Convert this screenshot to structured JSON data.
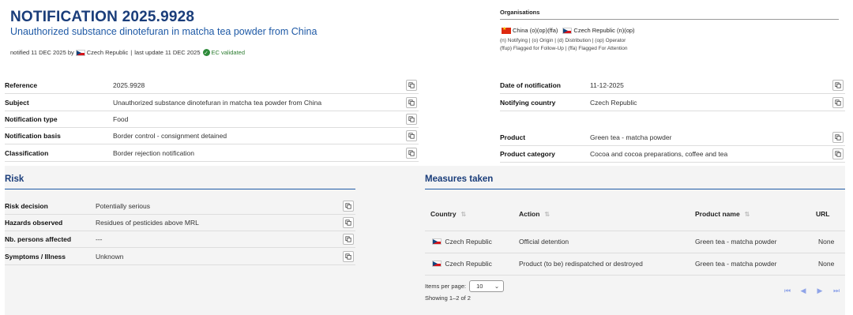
{
  "header": {
    "title": "NOTIFICATION 2025.9928",
    "subtitle": "Unauthorized substance dinotefuran in matcha tea powder from China",
    "notified_prefix": "notified 11 DEC 2025 by",
    "notified_country": "Czech Republic",
    "separator": "|",
    "last_update": "last update 11 DEC 2025",
    "ec_status": "EC validated"
  },
  "organisations": {
    "title": "Organisations",
    "items": [
      {
        "country": "China",
        "roles": "(o)(op)(ffa)"
      },
      {
        "country": "Czech Republic",
        "roles": "(n)(op)"
      }
    ],
    "legend_line1": "(n) Notifying | (o) Origin | (d) Distribution | (op) Operator",
    "legend_line2": "(ffup) Flagged for Follow-Up | (ffa) Flagged For Attention"
  },
  "details_left": [
    {
      "label": "Reference",
      "value": "2025.9928"
    },
    {
      "label": "Subject",
      "value": "Unauthorized substance dinotefuran in matcha tea powder from China"
    },
    {
      "label": "Notification type",
      "value": "Food"
    },
    {
      "label": "Notification basis",
      "value": "Border control - consignment detained"
    },
    {
      "label": "Classification",
      "value": "Border rejection notification"
    }
  ],
  "details_right": [
    {
      "label": "Date of notification",
      "value": "11-12-2025"
    },
    {
      "label": "Notifying country",
      "value": "Czech Republic"
    },
    {
      "label": "Product",
      "value": "Green tea - matcha powder"
    },
    {
      "label": "Product category",
      "value": "Cocoa and cocoa preparations, coffee and tea"
    }
  ],
  "risk": {
    "title": "Risk",
    "fields": [
      {
        "label": "Risk decision",
        "value": "Potentially serious"
      },
      {
        "label": "Hazards observed",
        "value": "Residues of pesticides above MRL"
      },
      {
        "label": "Nb. persons affected",
        "value": "---"
      },
      {
        "label": "Symptoms / Illness",
        "value": "Unknown"
      }
    ]
  },
  "measures": {
    "title": "Measures taken",
    "columns": [
      "Country",
      "Action",
      "Product name",
      "URL"
    ],
    "rows": [
      {
        "country": "Czech Republic",
        "action": "Official detention",
        "product": "Green tea - matcha powder",
        "url": "None"
      },
      {
        "country": "Czech Republic",
        "action": "Product (to be) redispatched or destroyed",
        "product": "Green tea - matcha powder",
        "url": "None"
      }
    ],
    "items_per_page_label": "Items per page:",
    "items_per_page_value": "10",
    "showing": "Showing 1–2 of 2"
  },
  "colors": {
    "title": "#1a3d7a",
    "accent": "#1f5aa6",
    "validated": "#2e7d32",
    "pager": "#8fa4e8"
  }
}
